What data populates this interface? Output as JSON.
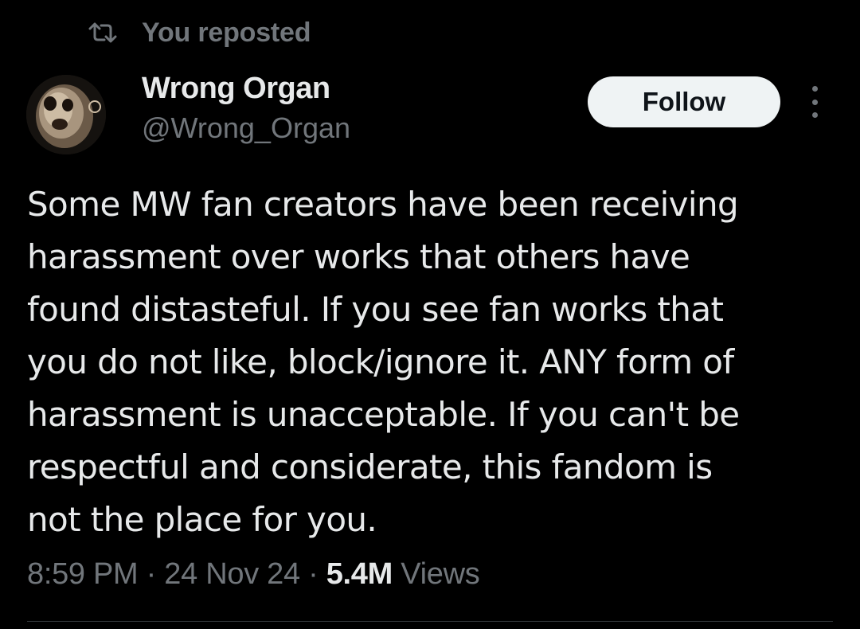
{
  "repost": {
    "icon": "repost-icon",
    "label": "You reposted"
  },
  "author": {
    "avatar": "avatar",
    "name": "Wrong Organ",
    "handle": "@Wrong_Organ"
  },
  "actions": {
    "follow_label": "Follow",
    "more_icon": "more-icon"
  },
  "tweet": {
    "lines": [
      "Some MW fan creators have been receiving",
      "harassment over works that others have",
      "found distasteful. If you see fan works that",
      "you do not like, block/ignore it. ANY form of",
      "harassment is unacceptable. If you can't be",
      "respectful and considerate, this fandom is",
      "not the place for you."
    ]
  },
  "meta": {
    "time": "8:59 PM",
    "sep1": " · ",
    "date": "24 Nov 24",
    "sep2": " · ",
    "views_count": "5.4M",
    "views_label": " Views"
  },
  "colors": {
    "background": "#000000",
    "text_primary": "#e7e9ea",
    "text_secondary": "#71767b",
    "button_bg": "#eff3f4",
    "button_text": "#0f1419",
    "divider": "#2f3336"
  }
}
